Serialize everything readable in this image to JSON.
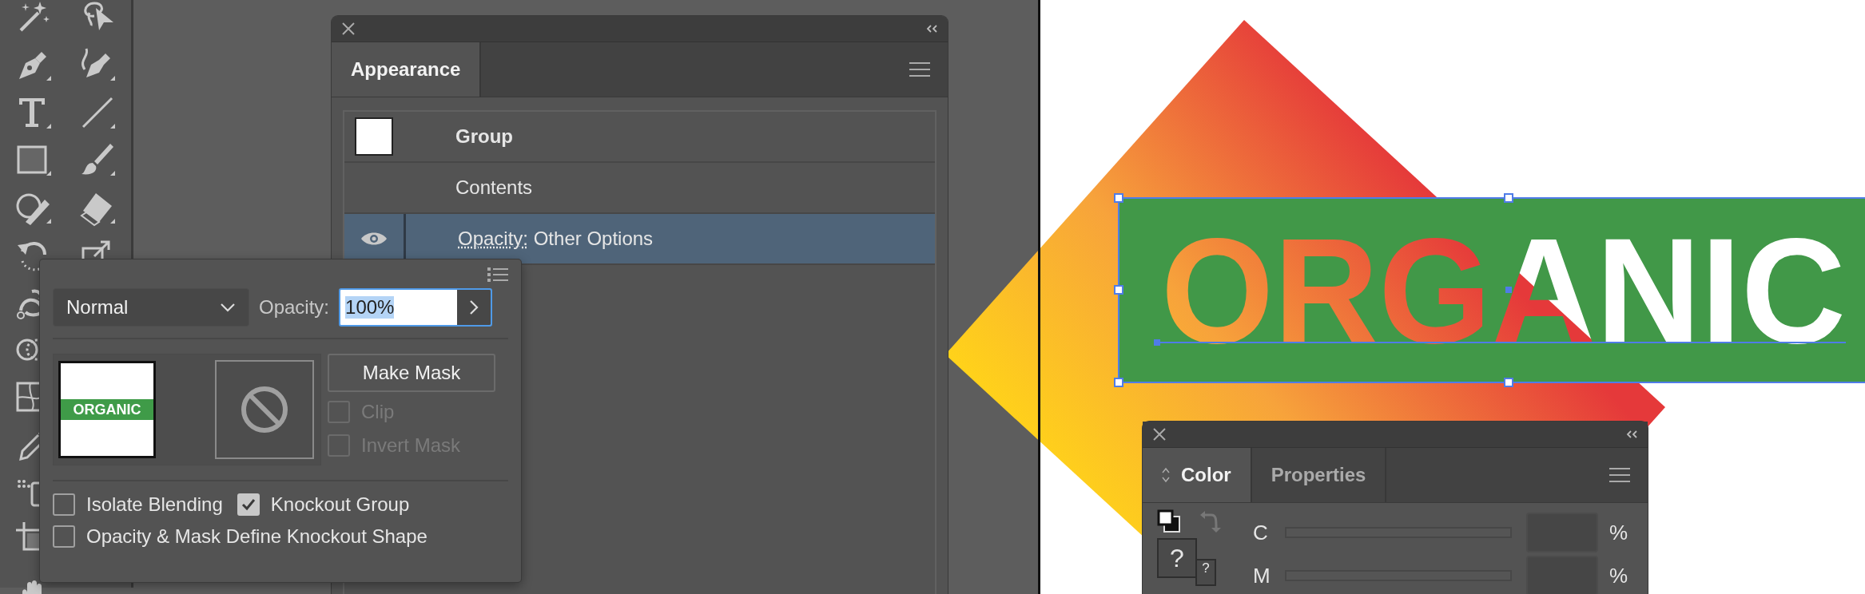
{
  "appearance_panel": {
    "tabs": [
      {
        "label": "Appearance",
        "selected": true
      }
    ],
    "rows": [
      {
        "kind": "swatch",
        "label": "Group",
        "selected": false
      },
      {
        "kind": "plain",
        "label": "Contents",
        "selected": false
      },
      {
        "kind": "attribute",
        "label": "Opacity:",
        "value": "Other Options",
        "selected": true
      }
    ]
  },
  "transparency_panel": {
    "blend_mode": "Normal",
    "opacity_label": "Opacity:",
    "opacity_value": "100%",
    "opacity_value_selected": true,
    "thumbnail_text": "ORGANIC",
    "make_mask_button": "Make Mask",
    "mask_options": [
      {
        "label": "Clip",
        "checked": false,
        "disabled": true
      },
      {
        "label": "Invert Mask",
        "checked": false,
        "disabled": true
      }
    ],
    "options": [
      {
        "label": "Isolate Blending",
        "checked": false,
        "disabled": false
      },
      {
        "label": "Knockout Group",
        "checked": true,
        "disabled": false
      },
      {
        "label": "Opacity & Mask Define Knockout Shape",
        "checked": false,
        "disabled": false
      }
    ]
  },
  "canvas": {
    "artwork_text": "ORGANIC"
  },
  "color_panel": {
    "tabs": [
      {
        "label": "Color",
        "selected": true
      },
      {
        "label": "Properties",
        "selected": false
      }
    ],
    "swatch_marks": [
      "?",
      "?"
    ],
    "channels": [
      {
        "label": "C",
        "unit": "%"
      },
      {
        "label": "M",
        "unit": "%"
      }
    ]
  }
}
